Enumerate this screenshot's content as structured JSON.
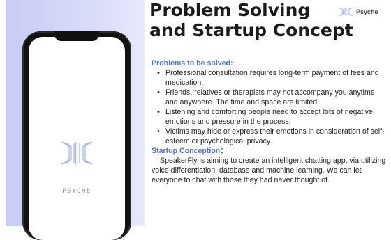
{
  "slide": {
    "title_line1": "Problem Solving",
    "title_line2": "and Startup Concept",
    "corner_brand": "Psyche"
  },
  "phone": {
    "brand_text": "PSYCHE",
    "logo_icon": "butterfly-icon"
  },
  "problems": {
    "heading": "Problems to be solved:",
    "items": [
      "Professional consultation requires long-term payment of fees and medication.",
      "Friends, relatives or therapists may not accompany you anytime and anywhere. The time and space are limited.",
      "Listening and comforting people need to accept lots of negative emotions and pressure in the process.",
      " Victims may hide or express their emotions in consideration of self-esteem or psychological privacy."
    ]
  },
  "startup": {
    "heading": "Startup Conception：",
    "paragraph": "SpeakerFly is aiming to create an intelligent chatting app, via utilizing voice differentiation, database and machine learning. We can let everyone to chat with those they had never thought of."
  },
  "colors": {
    "accent_heading": "#4a74d8",
    "left_panel": "#c7cbf6",
    "phone_frame": "#111111"
  }
}
